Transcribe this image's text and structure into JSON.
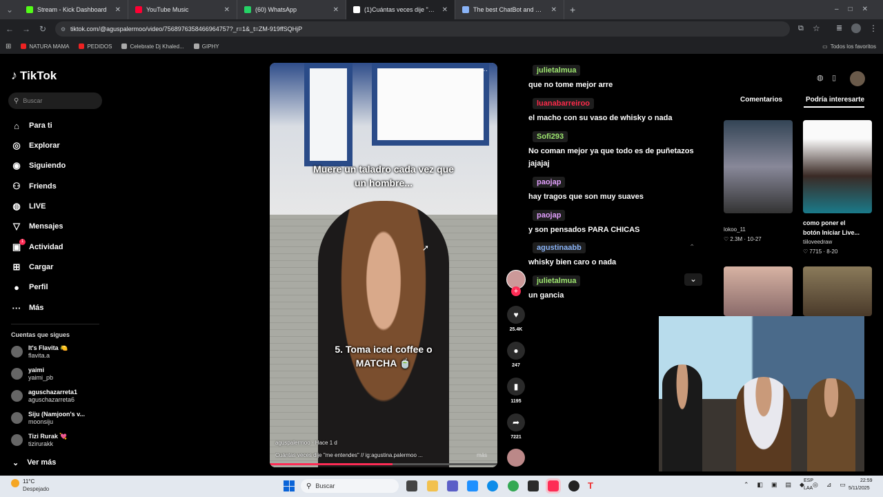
{
  "tabs": [
    {
      "title": "Stream - Kick Dashboard",
      "color": "#53fc18",
      "close": "✕"
    },
    {
      "title": "YouTube Music",
      "color": "#ff0033",
      "close": "✕"
    },
    {
      "title": "(60) WhatsApp",
      "color": "#25d366",
      "close": "✕"
    },
    {
      "title": "(1)Cuántas veces dije \"me ente",
      "color": "#ffffff",
      "close": "✕"
    },
    {
      "title": "The best ChatBot and Widgets",
      "color": "#8ab4f8",
      "close": "✕"
    }
  ],
  "new_tab": "+",
  "url": "tiktok.com/@aguspalermoo/video/7568976358466964757?_r=1&_t=ZM-919ffSQHjP",
  "bookmarks": [
    "NATURA MAMA",
    "PEDIDOS",
    "Celebrate Dj Khaled...",
    "GIPHY"
  ],
  "bookmarks_right": "Todos los favoritos",
  "brand": "TikTok",
  "search_placeholder": "Buscar",
  "nav": [
    {
      "label": "Para ti",
      "icon": "⌂"
    },
    {
      "label": "Explorar",
      "icon": "◎"
    },
    {
      "label": "Siguiendo",
      "icon": "◉"
    },
    {
      "label": "Friends",
      "icon": "⚇"
    },
    {
      "label": "LIVE",
      "icon": "◍"
    },
    {
      "label": "Mensajes",
      "icon": "▽"
    },
    {
      "label": "Actividad",
      "icon": "▣"
    },
    {
      "label": "Cargar",
      "icon": "⊞"
    },
    {
      "label": "Perfil",
      "icon": "●"
    },
    {
      "label": "Más",
      "icon": "···"
    }
  ],
  "activity_badge": "1",
  "following_title": "Cuentas que sigues",
  "following": [
    {
      "name": "It's Flavita 🍋",
      "handle": "flavita.a"
    },
    {
      "name": "yaimi",
      "handle": "yaimi_pb"
    },
    {
      "name": "aguschazarreta1",
      "handle": "aguschazarreta6"
    },
    {
      "name": "Siju (Namjoon's v...",
      "handle": "moonsiju"
    },
    {
      "name": "Tizi Rurak 💘",
      "handle": "tizirurakk"
    }
  ],
  "see_more": "Ver más",
  "video": {
    "caption_top": "Muere un taladro cada vez que un hombre...",
    "caption_bottom": "5. Toma iced coffee o MATCHA 🍵",
    "author": "aguspalermoo · Hace 1 d",
    "desc": "Cuántas veces dije \"me entendes\" // ig:agustina.palermoo ...",
    "more": "más",
    "dots": "···"
  },
  "actions": {
    "likes": "25.4K",
    "comments": "247",
    "saves": "1195",
    "shares": "7221",
    "follow_plus": "+"
  },
  "comments": [
    {
      "user": "julietalmua",
      "text": "que no tome mejor arre",
      "color": "#9fe870"
    },
    {
      "user": "luanabarreiroo",
      "text": "el macho con su vaso de whisky o nada",
      "color": "#ff2a4a"
    },
    {
      "user": "Sofi293",
      "text": "No coman mejor ya que todo es de puñetazos jajajaj",
      "color": "#9fe870"
    },
    {
      "user": "paojap",
      "text": "hay tragos que son muy suaves",
      "color": "#e3a0ff"
    },
    {
      "user": "paojap",
      "text": "y son pensados PARA CHICAS",
      "color": "#e3a0ff"
    },
    {
      "user": "agustinaabb",
      "text": "whisky bien caro o nada",
      "color": "#8ab4f8"
    },
    {
      "user": "julietalmua",
      "text": "un gancia",
      "color": "#9fe870"
    }
  ],
  "right_tabs": {
    "comments": "Comentarios",
    "interest": "Podría interesarte"
  },
  "cards": [
    {
      "title": "lokoo_11",
      "stats": "♡ 2.3M · 10-27",
      "author": ""
    },
    {
      "title": "como poner el botón Iniciar Live...",
      "stats": "♡ 7715 · 8-20",
      "author": "tiiloveedraw"
    }
  ],
  "weather": {
    "temp": "11°C",
    "cond": "Despejado"
  },
  "taskbar_search": "Buscar",
  "tray": {
    "lang1": "ESP",
    "lang2": "LAA",
    "time": "22:59",
    "date": "5/11/2025"
  }
}
